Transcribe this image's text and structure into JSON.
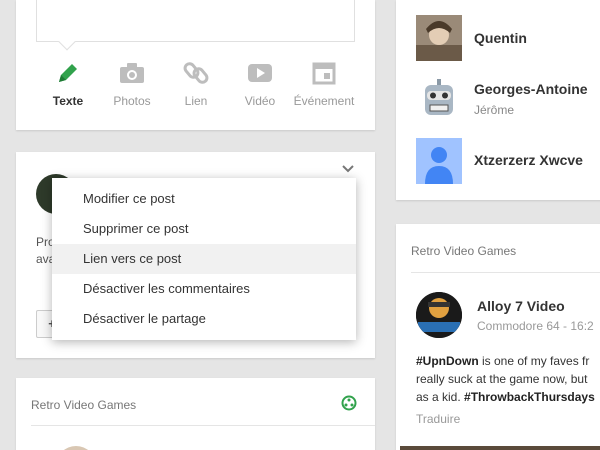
{
  "composer": {
    "options": [
      {
        "label": "Texte",
        "icon": "pencil-icon",
        "active": true
      },
      {
        "label": "Photos",
        "icon": "camera-icon",
        "active": false
      },
      {
        "label": "Lien",
        "icon": "link-icon",
        "active": false
      },
      {
        "label": "Vidéo",
        "icon": "video-icon",
        "active": false
      },
      {
        "label": "Événement",
        "icon": "event-icon",
        "active": false
      }
    ],
    "accent_color": "#31a24c"
  },
  "post": {
    "text_line1": "Pro",
    "text_line2": "ava",
    "plus_label": "+"
  },
  "menu": {
    "items": [
      {
        "label": "Modifier ce post"
      },
      {
        "label": "Supprimer ce post"
      },
      {
        "label": "Lien vers ce post"
      },
      {
        "label": "Désactiver les commentaires"
      },
      {
        "label": "Désactiver le partage"
      }
    ]
  },
  "retro_left": {
    "title": "Retro Video Games"
  },
  "people": [
    {
      "name": "Quentin",
      "sub": ""
    },
    {
      "name": "Georges-Antoine",
      "sub": "Jérôme"
    },
    {
      "name": "Xtzerzerz Xwcve",
      "sub": ""
    }
  ],
  "retro_right": {
    "title": "Retro Video Games",
    "author": "Alloy 7 Video",
    "meta": "Commodore 64  -  16:2",
    "hashtag1": "#UpnDown",
    "body_line1_rest": " is one of my faves fr",
    "body_line2": "really suck at the game now, but",
    "body_line3_start": "as a kid. ",
    "hashtag2": "#ThrowbackThursdays",
    "translate": "Traduire"
  }
}
